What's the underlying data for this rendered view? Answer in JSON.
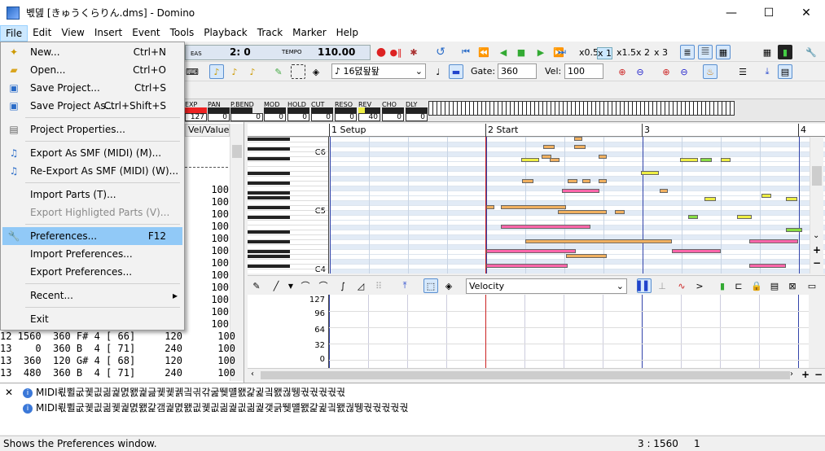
{
  "window": {
    "title": "볛뎶 [きゅうくらりん.dms] - Domino",
    "minimize": "—",
    "maximize": "☐",
    "close": "✕"
  },
  "menubar": [
    "File",
    "Edit",
    "View",
    "Insert",
    "Event",
    "Tools",
    "Playback",
    "Track",
    "Marker",
    "Help"
  ],
  "file_menu": {
    "items": [
      {
        "label": "New...",
        "shortcut": "Ctrl+N",
        "icon": "new-file-icon",
        "disabled": false
      },
      {
        "label": "Open...",
        "shortcut": "Ctrl+O",
        "icon": "open-folder-icon",
        "disabled": false
      },
      {
        "label": "Save Project...",
        "shortcut": "Ctrl+S",
        "icon": "save-icon",
        "disabled": false
      },
      {
        "label": "Save Project As...",
        "shortcut": "Ctrl+Shift+S",
        "icon": "save-as-icon",
        "disabled": false
      },
      {
        "label": "Project Properties...",
        "shortcut": "",
        "icon": "properties-icon",
        "disabled": false
      },
      {
        "label": "Export As SMF (MIDI) (M)...",
        "shortcut": "",
        "icon": "export-smf-icon",
        "disabled": false
      },
      {
        "label": "Re-Export As SMF (MIDI) (W)...",
        "shortcut": "",
        "icon": "reexport-smf-icon",
        "disabled": false
      },
      {
        "label": "Import Parts (T)...",
        "shortcut": "",
        "icon": "",
        "disabled": false
      },
      {
        "label": "Export Highligted Parts (V)...",
        "shortcut": "",
        "icon": "",
        "disabled": true
      },
      {
        "label": "Preferences...",
        "shortcut": "F12",
        "icon": "wrench-icon",
        "disabled": false,
        "highlighted": true
      },
      {
        "label": "Import Preferences...",
        "shortcut": "",
        "icon": "",
        "disabled": false
      },
      {
        "label": "Export Preferences...",
        "shortcut": "",
        "icon": "",
        "disabled": false
      },
      {
        "label": "Recent...",
        "shortcut": "▸",
        "icon": "",
        "disabled": false
      },
      {
        "label": "Exit",
        "shortcut": "",
        "icon": "",
        "disabled": false
      }
    ]
  },
  "toolbar": {
    "meas_label": "EAS",
    "position": "2:  0",
    "tempo_label": "TEMPO",
    "tempo": "110.00",
    "speed_x05": "x0.5",
    "speed_x1": "x 1",
    "speed_x15": "x1.5",
    "speed_x2": "x 2",
    "speed_x3": "x 3",
    "note_length": "16뎘돺돺",
    "gate_label": "Gate:",
    "gate_value": "360",
    "vel_label": "Vel:",
    "vel_value": "100"
  },
  "mixer": {
    "labels": [
      "EXP",
      "PAN",
      "P.BEND",
      "MOD",
      "HOLD",
      "CUT",
      "RESO",
      "REV",
      "CHO",
      "DLY"
    ],
    "values": [
      "127",
      "0",
      "0",
      "0",
      "0",
      "0",
      "0",
      "40",
      "0",
      "0"
    ]
  },
  "event_list": {
    "header_value": "Vel/Value",
    "velocity_values": [
      "100",
      "100",
      "100",
      "100",
      "100",
      "100",
      "100",
      "100",
      "100",
      "100",
      "100",
      "100",
      "100",
      "100",
      "100",
      "100"
    ],
    "rows": [
      {
        "text": "12 1560  360 F# 4 [ 66]     120      100"
      },
      {
        "text": "13    0  360 B  4 [ 71]     240      100"
      },
      {
        "text": "13  360  120 G# 4 [ 68]     120      100"
      },
      {
        "text": "13  480  360 B  4 [ 71]     240      100"
      }
    ]
  },
  "piano_roll": {
    "markers": [
      "1 Setup",
      "2 Start",
      "3",
      "4"
    ],
    "octave_labels": [
      "C6",
      "C5",
      "C4"
    ]
  },
  "velocity_pane": {
    "control": "Velocity",
    "ticks": [
      "127",
      "96",
      "64",
      "32",
      "0"
    ]
  },
  "log": {
    "lines": [
      "MIDI뢳쀨굾궻긦긞궕멼뫬궕긆궻궻궭긬긖갂굺뛪먤뫬갍귍긬뫬궎뛩궋궋궋궋궋",
      "MIDI뢳쀨굾궻긦긞궻궕멼뫬갍갬궕멼뫬긦궻긦긞궕긦긞궕갲긁뛪먤뫬갍귍긬뫬궎뛩궋궋궋궋궋"
    ],
    "close": "✕"
  },
  "status": {
    "text": "Shows the Preferences window.",
    "position": "3 : 1560",
    "track": "1"
  }
}
